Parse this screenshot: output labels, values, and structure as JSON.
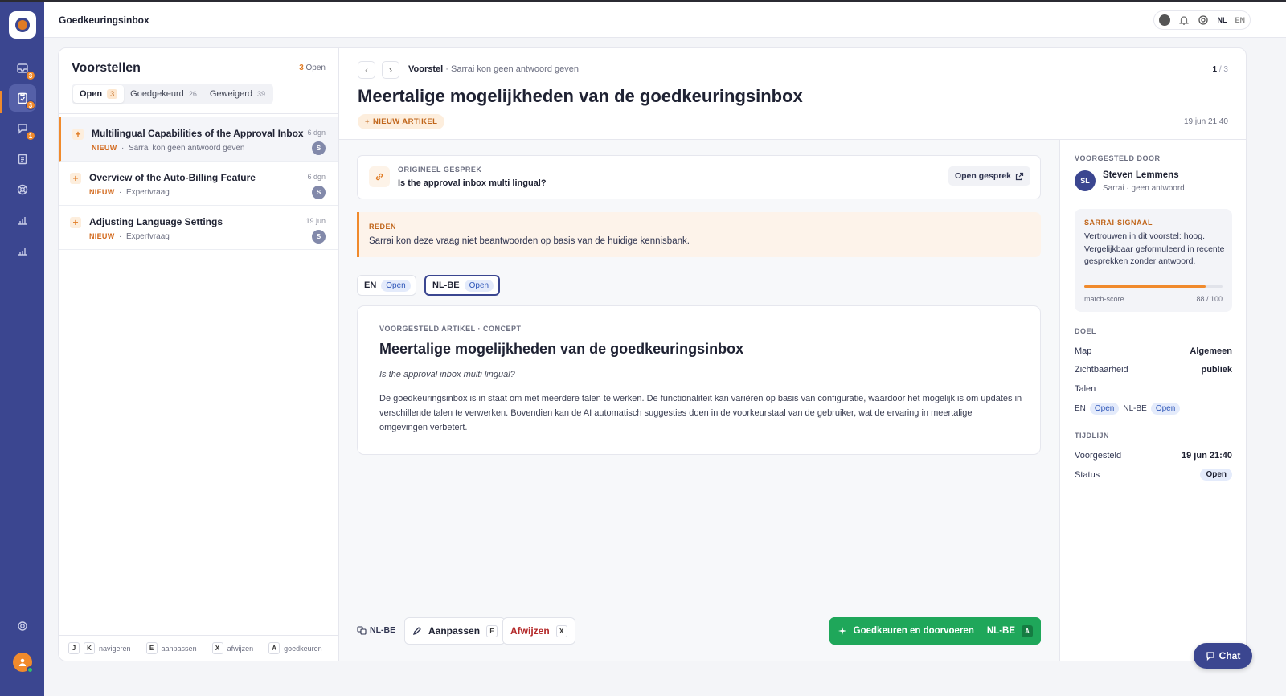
{
  "header": {
    "title": "Goedkeuringsinbox",
    "lang_nl": "NL",
    "lang_en": "EN"
  },
  "rail": {
    "badges": [
      "3",
      "3",
      "1"
    ]
  },
  "list": {
    "title": "Voorstellen",
    "count_num": "3",
    "count_label": "Open",
    "tabs": [
      {
        "label": "Open",
        "count": "3"
      },
      {
        "label": "Goedgekeurd",
        "count": "26"
      },
      {
        "label": "Geweigerd",
        "count": "39"
      }
    ],
    "items": [
      {
        "title": "Multilingual Capabilities of the Approval Inbox",
        "tag": "NIEUW",
        "sub": "Sarrai kon geen antwoord geven",
        "date": "6 dgn",
        "avatar": "S"
      },
      {
        "title": "Overview of the Auto-Billing Feature",
        "tag": "NIEUW",
        "sub": "Expertvraag",
        "date": "6 dgn",
        "avatar": "S"
      },
      {
        "title": "Adjusting Language Settings",
        "tag": "NIEUW",
        "sub": "Expertvraag",
        "date": "19 jun",
        "avatar": "S"
      }
    ],
    "shortcuts": [
      {
        "keys": [
          "J",
          "K"
        ],
        "label": "navigeren"
      },
      {
        "keys": [
          "E"
        ],
        "label": "aanpassen"
      },
      {
        "keys": [
          "X"
        ],
        "label": "afwijzen"
      },
      {
        "keys": [
          "A"
        ],
        "label": "goedkeuren"
      }
    ]
  },
  "detail": {
    "crumb_bold": "Voorstel",
    "crumb_rest": "· Sarrai kon geen antwoord geven",
    "pager_current": "1",
    "pager_total": "/ 3",
    "title": "Meertalige mogelijkheden van de goedkeuringsinbox",
    "new_label": "NIEUW ARTIKEL",
    "date": "19 jun 21:40",
    "conversation": {
      "label": "ORIGINEEL GESPREK",
      "question": "Is the approval inbox multi lingual?",
      "open_label": "Open gesprek"
    },
    "reason": {
      "label": "REDEN",
      "text": "Sarrai kon deze vraag niet beantwoorden op basis van de huidige kennisbank."
    },
    "lang_tabs": [
      {
        "code": "EN",
        "status": "Open"
      },
      {
        "code": "NL-BE",
        "status": "Open"
      }
    ],
    "article": {
      "label": "VOORGESTELD ARTIKEL · CONCEPT",
      "title": "Meertalige mogelijkheden van de goedkeuringsinbox",
      "question": "Is the approval inbox multi lingual?",
      "body": "De goedkeuringsinbox is in staat om met meerdere talen te werken. De functionaliteit kan variëren op basis van configuratie, waardoor het mogelijk is om updates in verschillende talen te verwerken. Bovendien kan de AI automatisch suggesties doen in de voorkeurstaal van de gebruiker, wat de ervaring in meertalige omgevingen verbetert."
    },
    "actions": {
      "lang": "NL-BE",
      "edit_label": "Aanpassen",
      "edit_key": "E",
      "reject_label": "Afwijzen",
      "reject_key": "X",
      "approve_label": "Goedkeuren en doorvoeren",
      "approve_lang": "NL-BE",
      "approve_key": "A"
    }
  },
  "sidebar": {
    "suggested_label": "VOORGESTELD DOOR",
    "suggested_initials": "SL",
    "suggested_name": "Steven Lemmens",
    "suggested_sub": "Sarrai · geen antwoord",
    "signal_label": "SARRAI-SIGNAAL",
    "signal_text": "Vertrouwen in dit voorstel: hoog. Vergelijkbaar geformuleerd in recente gesprekken zonder antwoord.",
    "score_label": "match-score",
    "score_value": 88,
    "score_text": "88 / 100",
    "goal_label": "DOEL",
    "map_k": "Map",
    "map_v": "Algemeen",
    "vis_k": "Zichtbaarheid",
    "vis_v": "publiek",
    "talen_k": "Talen",
    "talen": [
      {
        "code": "EN",
        "status": "Open"
      },
      {
        "code": "NL-BE",
        "status": "Open"
      }
    ],
    "timeline_label": "TIJDLIJN",
    "proposed_k": "Voorgesteld",
    "proposed_v": "19 jun 21:40",
    "status_k": "Status",
    "status_v": "Open"
  },
  "chat": {
    "label": "Chat"
  },
  "colors": {
    "accent": "#3b4690",
    "orange": "#f08a2c",
    "approve": "#1fa75a"
  }
}
